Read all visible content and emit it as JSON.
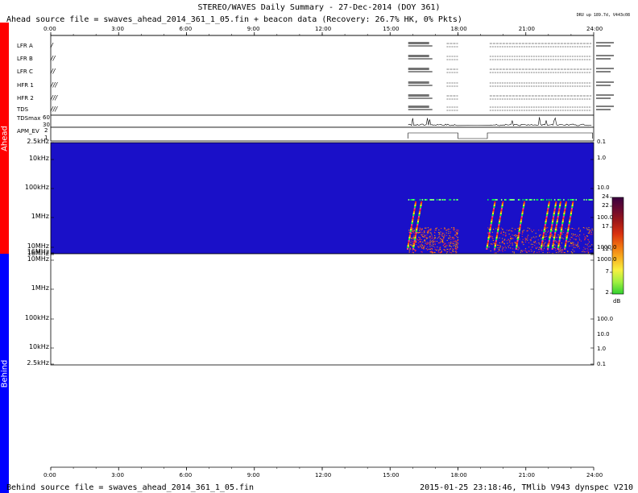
{
  "header": {
    "title": "STEREO/WAVES Daily Summary - 27-Dec-2014 (DOY 361)",
    "ahead_source": "Ahead source file = swaves_ahead_2014_361_1_05.fin + beacon data (Recovery: 26.7% HK,   0% Pkts)",
    "dru_status": "DRU up 189.7d, V443c08"
  },
  "footer": {
    "behind_source": "Behind source file = swaves_ahead_2014_361_1_05.fin",
    "generator": "2015-01-25 23:18:46, TMlib V943 dynspec V210"
  },
  "sidebars": {
    "ahead_label": "Ahead",
    "behind_label": "Behind",
    "ahead_color": "#ff0000",
    "behind_color": "#0000ff"
  },
  "time_axis": {
    "ticks": [
      "0:00",
      "3:00",
      "6:00",
      "9:00",
      "12:00",
      "15:00",
      "18:00",
      "21:00",
      "24:00"
    ]
  },
  "status_rows": [
    {
      "label": "LFR A",
      "glyph": "/"
    },
    {
      "label": "LFR B",
      "glyph": "//"
    },
    {
      "label": "LFR C",
      "glyph": "//"
    },
    {
      "label": "HFR 1",
      "glyph": "///"
    },
    {
      "label": "HFR 2",
      "glyph": "///"
    },
    {
      "label": "TDS",
      "glyph": "///"
    },
    {
      "label": "TDSmax",
      "glyph": ""
    },
    {
      "label": "APM_EV",
      "glyph": ""
    }
  ],
  "tdsmax_scale": {
    "top": "60",
    "mid": "30",
    "bottom": "0"
  },
  "apm_scale": {
    "top": "2",
    "bottom": "1"
  },
  "ahead_panel": {
    "freq_labels": [
      "2.5kHz",
      "10kHz",
      "100kHz",
      "1MHz",
      "10MHz",
      "16MHz"
    ],
    "right_labels": [
      "0.1",
      "1.0",
      "10.0",
      "100.0",
      "1000.0"
    ],
    "background_color": "#1a10c8"
  },
  "behind_panel": {
    "freq_labels": [
      "16MHz",
      "10MHz",
      "1MHz",
      "100kHz",
      "10kHz",
      "2.5kHz"
    ],
    "right_labels": [
      "1000.0",
      "100.0",
      "10.0",
      "1.0",
      "0.1"
    ]
  },
  "colorbar": {
    "ticks": [
      "24",
      "22",
      "17",
      "12",
      "7",
      "2"
    ],
    "unit": "dB"
  }
}
